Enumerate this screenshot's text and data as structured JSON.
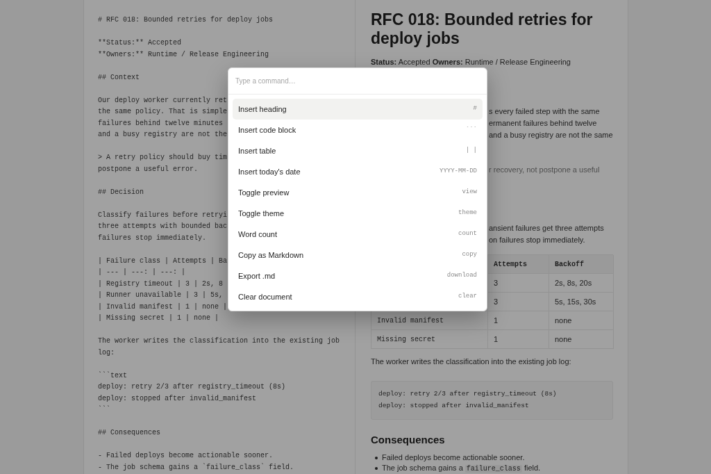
{
  "editor": {
    "blocks": [
      {
        "lines": [
          "# RFC 018: Bounded retries for deploy jobs"
        ]
      },
      {
        "lines": [
          "**Status:** Accepted",
          "**Owners:** Runtime / Release Engineering"
        ]
      },
      {
        "lines": [
          "## Context"
        ]
      },
      {
        "lines": [
          "Our deploy worker currently ret",
          "the same policy. That is simple",
          "failures behind twelve minutes",
          "and a busy registry are not the"
        ]
      },
      {
        "lines": [
          "> A retry policy should buy tim",
          "postpone a useful error."
        ]
      },
      {
        "lines": [
          "## Decision"
        ]
      },
      {
        "lines": [
          "Classify failures before retryi",
          "three attempts with bounded bac",
          "failures stop immediately."
        ]
      },
      {
        "lines": [
          "| Failure class | Attempts | Ba",
          "| --- | ---: | ---: |",
          "| Registry timeout | 3 | 2s, 8",
          "| Runner unavailable | 3 | 5s,",
          "| Invalid manifest | 1 | none |",
          "| Missing secret | 1 | none |"
        ]
      },
      {
        "lines": [
          "The worker writes the classification into the existing job log:"
        ]
      },
      {
        "lines": [
          "```text",
          "deploy: retry 2/3 after registry_timeout (8s)",
          "deploy: stopped after invalid_manifest",
          "```"
        ]
      },
      {
        "lines": [
          "## Consequences"
        ]
      },
      {
        "lines": [
          "- Failed deploys become actionable sooner.",
          "- The job schema gains a `failure_class` field."
        ]
      }
    ]
  },
  "preview": {
    "title": "RFC 018: Bounded retries for deploy jobs",
    "meta": "**Status:** Accepted **Owners:** Runtime / Release Engineering",
    "paragraph_1": {
      "lines": [
        "s every failed step with the same",
        "ermanent failures behind twelve",
        "and a busy registry are not the same"
      ]
    },
    "blockquote": {
      "lines": [
        "r recovery, not postpone a useful"
      ]
    },
    "paragraph_2": {
      "lines": [
        "ansient failures get three attempts",
        "on failures stop immediately."
      ]
    },
    "table": {
      "header": {
        "cells": [
          "Attempts",
          "Backoff"
        ]
      },
      "rows": [
        {
          "cells": [
            "3",
            "2s, 8s, 20s"
          ]
        },
        {
          "cells": [
            "3",
            "5s, 15s, 30s"
          ]
        },
        {
          "cells": [
            "Invalid manifest",
            "1",
            "none"
          ]
        },
        {
          "cells": [
            "Missing secret",
            "1",
            "none"
          ]
        }
      ]
    },
    "paragraph_3": "The worker writes the classification into the existing job log:",
    "code_block": {
      "lines": [
        "deploy: retry 2/3 after registry_timeout (8s)",
        "deploy: stopped after invalid_manifest"
      ]
    },
    "heading": "Consequences",
    "bullets": [
      {
        "parts": [
          {
            "kind": "text",
            "text": "Failed deploys become actionable sooner."
          }
        ]
      },
      {
        "parts": [
          {
            "kind": "text",
            "text": "The job schema gains a "
          },
          {
            "kind": "code",
            "text": "failure_class"
          },
          {
            "kind": "text",
            "text": " field."
          }
        ]
      }
    ]
  },
  "command_palette": {
    "placeholder": "Type a command…",
    "commands": [
      {
        "label": "Insert heading",
        "hint": "#",
        "selected": true
      },
      {
        "label": "Insert code block",
        "hint": "```",
        "selected": false
      },
      {
        "label": "Insert table",
        "hint": "| |",
        "selected": false
      },
      {
        "label": "Insert today's date",
        "hint": "YYYY-MM-DD",
        "selected": false
      },
      {
        "label": "Toggle preview",
        "hint": "view",
        "selected": false
      },
      {
        "label": "Toggle theme",
        "hint": "theme",
        "selected": false
      },
      {
        "label": "Word count",
        "hint": "count",
        "selected": false
      },
      {
        "label": "Copy as Markdown",
        "hint": "copy",
        "selected": false
      },
      {
        "label": "Export .md",
        "hint": "download",
        "selected": false
      },
      {
        "label": "Clear document",
        "hint": "clear",
        "selected": false
      }
    ]
  }
}
